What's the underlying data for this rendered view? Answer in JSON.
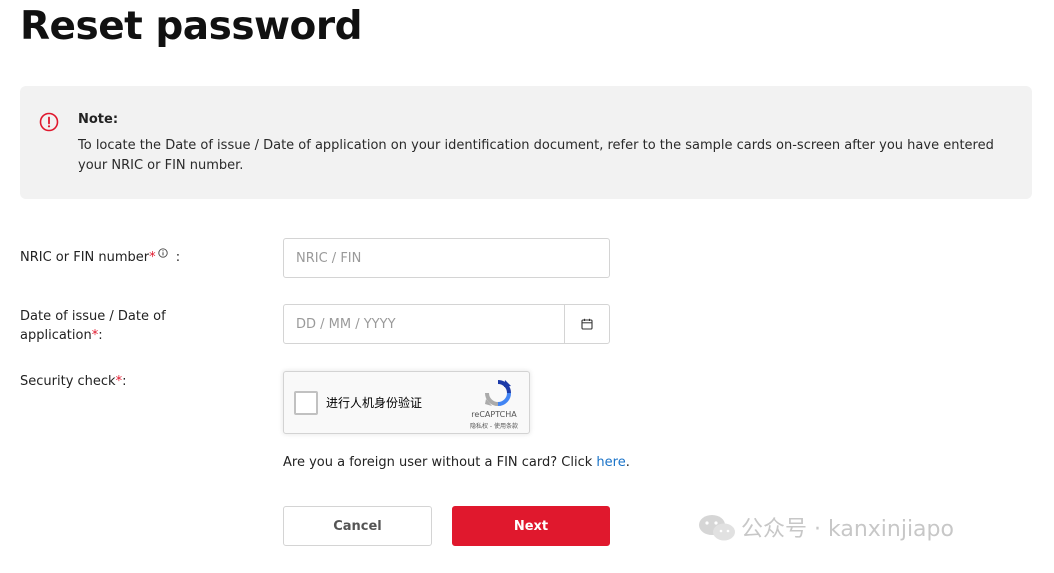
{
  "page": {
    "title": "Reset password"
  },
  "note": {
    "heading": "Note:",
    "text": "To locate the Date of issue / Date of application on your identification document, refer to the sample cards on-screen after you have entered your NRIC or FIN number.",
    "icon": "info-circle-icon"
  },
  "form": {
    "nric": {
      "label": "NRIC or FIN number",
      "required_mark": "*",
      "suffix": ":",
      "placeholder": "NRIC / FIN",
      "value": ""
    },
    "date": {
      "label_line1": "Date of issue / Date of",
      "label_line2": "application",
      "required_mark": "*",
      "suffix": ":",
      "placeholder": "DD / MM / YYYY",
      "value": ""
    },
    "security": {
      "label": "Security check",
      "required_mark": "*",
      "suffix": ":"
    }
  },
  "captcha": {
    "label": "进行人机身份验证",
    "brand": "reCAPTCHA",
    "terms": "隐私权 - 使用条款"
  },
  "foreign_user": {
    "text": "Are you a foreign user without a FIN card? Click ",
    "link": "here",
    "end": "."
  },
  "buttons": {
    "cancel": "Cancel",
    "next": "Next"
  },
  "watermark": {
    "text": "公众号 · kanxinjiapo"
  },
  "colors": {
    "accent": "#e0182d",
    "link": "#1a73c8",
    "note_bg": "#f2f2f2"
  }
}
